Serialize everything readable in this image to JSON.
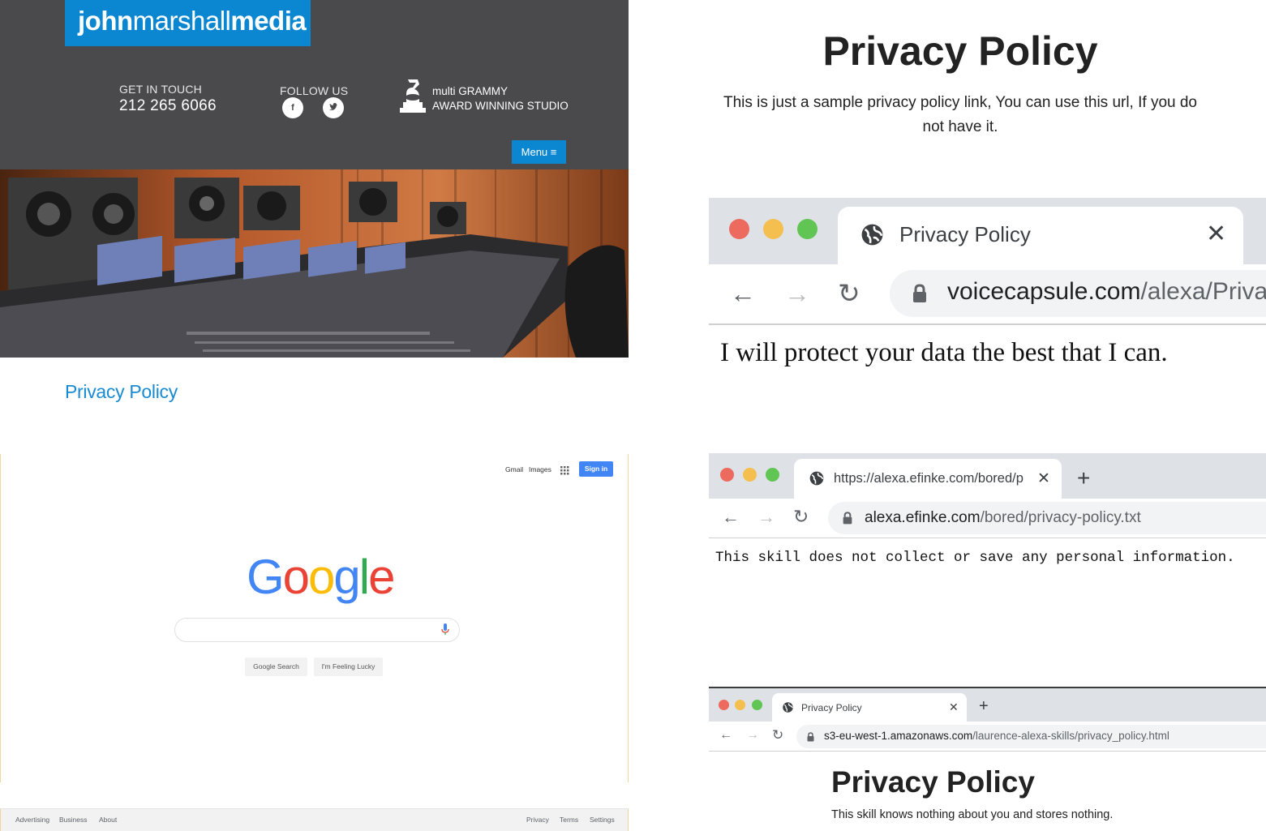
{
  "panel_jm": {
    "logo_part1": "john",
    "logo_part2": "marshall",
    "logo_part3": "media",
    "get_in_touch": "GET IN TOUCH",
    "phone": "212 265 6066",
    "follow_us": "FOLLOW US",
    "social": [
      {
        "label": "f",
        "icon": "facebook-icon"
      },
      {
        "label": "t",
        "icon": "twitter-icon"
      }
    ],
    "grammy_line1": "multi GRAMMY",
    "grammy_line2": "AWARD WINNING STUDIO",
    "menu_label": "Menu ≡",
    "privacy_link": "Privacy Policy",
    "accent": "#0b86d1",
    "header_bg": "#4a4a4d"
  },
  "panel_text": {
    "title": "Privacy Policy",
    "body": "This is just a sample privacy policy link, You can use this url, If you do not have it."
  },
  "browser_voicecapsule": {
    "tab_title": "Privacy Policy",
    "url_domain": "voicecapsule.com",
    "url_path": "/alexa/Privac",
    "content": "I will protect your data the best that I can."
  },
  "browser_efinke": {
    "tab_title": "https://alexa.efinke.com/bored/p",
    "url_domain": "alexa.efinke.com",
    "url_path": "/bored/privacy-policy.txt",
    "content": "This skill does not collect or save any personal information."
  },
  "browser_s3": {
    "tab_title": "Privacy Policy",
    "url_domain": "s3-eu-west-1.amazonaws.com",
    "url_path": "/laurence-alexa-skills/privacy_policy.html",
    "title": "Privacy Policy",
    "body": "This skill knows nothing about you and stores nothing."
  },
  "google": {
    "gmail": "Gmail",
    "images": "Images",
    "sign_in": "Sign in",
    "logo_letters": [
      "G",
      "o",
      "o",
      "g",
      "l",
      "e"
    ],
    "logo_colors": [
      "#4285f4",
      "#ea4335",
      "#fbbc05",
      "#4285f4",
      "#34a853",
      "#ea4335"
    ],
    "search_button": "Google Search",
    "lucky_button": "I'm Feeling Lucky",
    "footer_left": [
      "Advertising",
      "Business",
      "About"
    ],
    "footer_right": [
      "Privacy",
      "Terms",
      "Settings"
    ]
  },
  "window_controls": {
    "close": "#ec6a5e",
    "minimize": "#f4bf4f",
    "maximize": "#61c554"
  }
}
